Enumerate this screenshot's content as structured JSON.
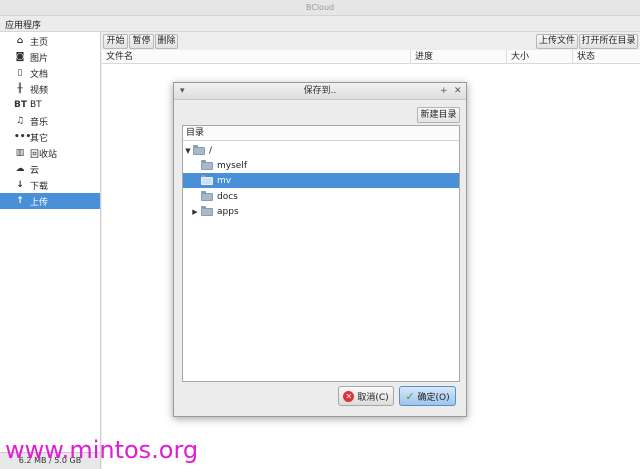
{
  "window": {
    "title": "BCloud"
  },
  "menu": {
    "label": "应用程序"
  },
  "sidebar": {
    "items": [
      {
        "label": "主页",
        "icon": "home-icon"
      },
      {
        "label": "图片",
        "icon": "camera-icon"
      },
      {
        "label": "文档",
        "icon": "document-icon"
      },
      {
        "label": "视频",
        "icon": "film-icon"
      },
      {
        "label": "BT",
        "icon": "bt-icon"
      },
      {
        "label": "音乐",
        "icon": "music-icon"
      },
      {
        "label": "其它",
        "icon": "more-icon"
      },
      {
        "label": "回收站",
        "icon": "trash-icon"
      },
      {
        "label": "云",
        "icon": "cloud-icon"
      },
      {
        "label": "下载",
        "icon": "download-icon"
      },
      {
        "label": "上传",
        "icon": "upload-icon"
      }
    ],
    "active_index": 10,
    "quota": "6.2 MB / 5.0 GB"
  },
  "toolbar": {
    "start": "开始",
    "pause": "暂停",
    "delete": "删除",
    "upload_file": "上传文件",
    "open_dir": "打开所在目录"
  },
  "table": {
    "columns": [
      "文件名",
      "进度",
      "大小",
      "状态"
    ]
  },
  "dialog": {
    "title": "保存到..",
    "new_dir": "新建目录",
    "tree_header": "目录",
    "rows": [
      {
        "label": "/",
        "expanded": true
      },
      {
        "label": "myself"
      },
      {
        "label": "mv",
        "selected": true
      },
      {
        "label": "docs"
      },
      {
        "label": "apps",
        "collapsed": true
      }
    ],
    "cancel": "取消(C)",
    "ok": "确定(O)"
  },
  "watermark": "www.mintos.org",
  "colors": {
    "accent": "#4a90d9",
    "watermark": "#e01cd6"
  }
}
